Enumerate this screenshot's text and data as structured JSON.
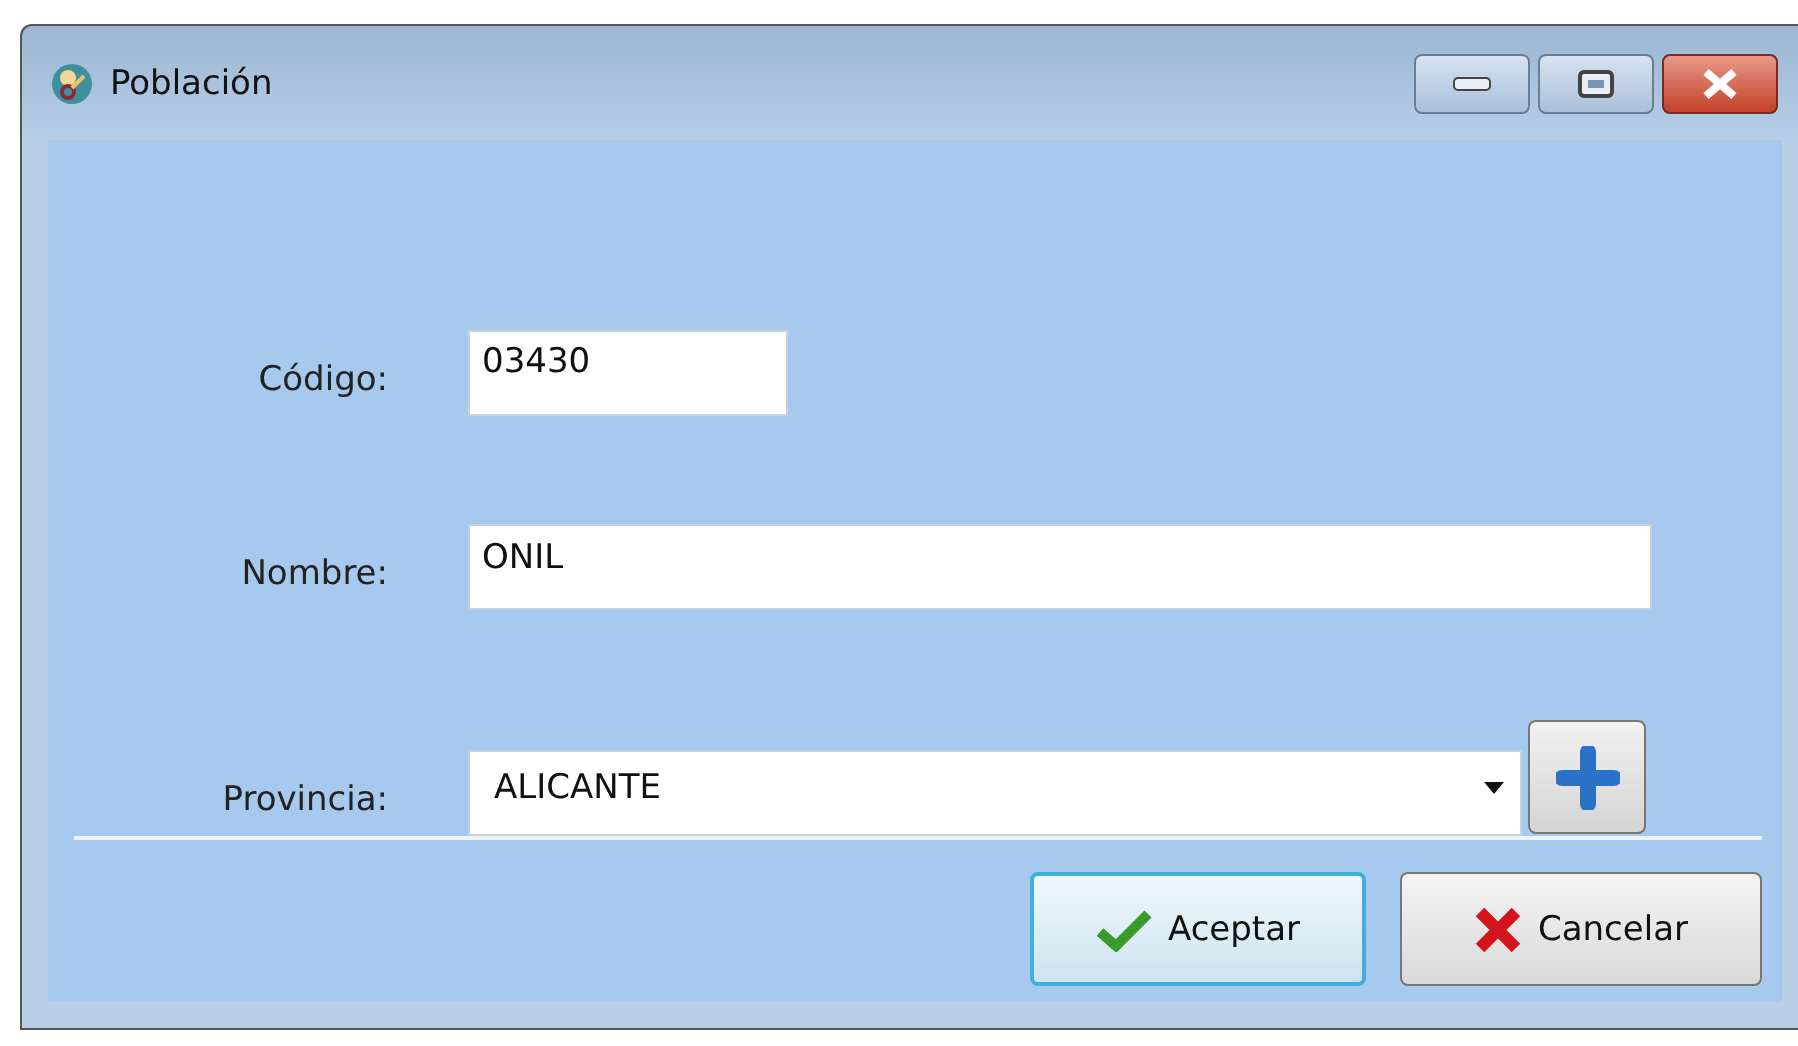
{
  "window": {
    "title": "Población"
  },
  "fields": [
    {
      "label": "Código:",
      "value": "03430",
      "kind": "short"
    },
    {
      "label": "Nombre:",
      "value": "ONIL",
      "kind": "wide"
    },
    {
      "label": "Provincia:",
      "value": "ALICANTE",
      "kind": "combo"
    }
  ],
  "buttons": [
    {
      "label": "Aceptar",
      "kind": "ok",
      "default": true
    },
    {
      "label": "Cancelar",
      "kind": "cancel",
      "default": false
    }
  ]
}
